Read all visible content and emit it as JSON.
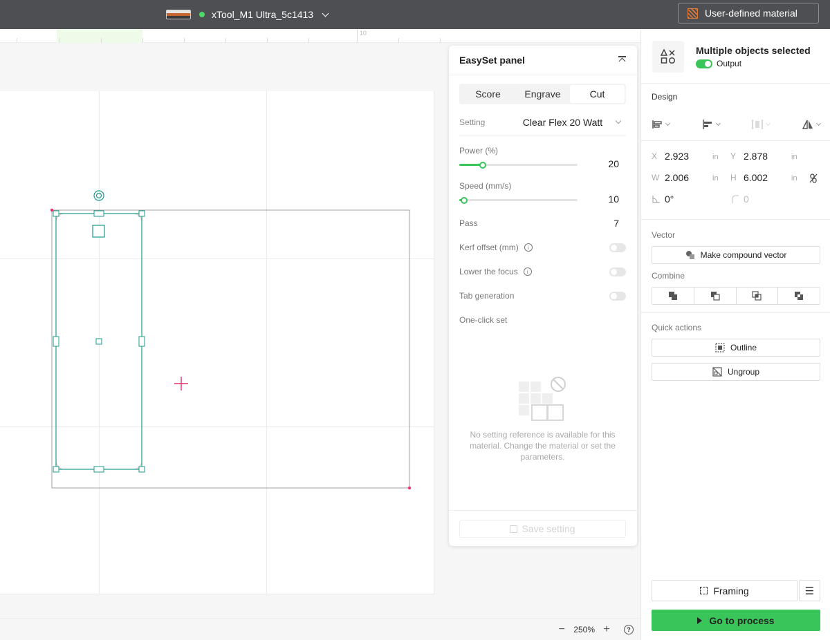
{
  "topbar": {
    "device_name": "xTool_M1 Ultra_5c1413",
    "device_status": "connected",
    "material_label": "User-defined material",
    "icons": [
      "device-thumbnail-icon",
      "chevron-down-icon",
      "material-icon"
    ]
  },
  "ruler": {
    "mark_label": "10"
  },
  "easyset": {
    "title": "EasySet panel",
    "tabs": [
      {
        "label": "Score",
        "active": false
      },
      {
        "label": "Engrave",
        "active": false
      },
      {
        "label": "Cut",
        "active": true
      }
    ],
    "setting_label": "Setting",
    "setting_value": "Clear Flex 20 Watt",
    "power": {
      "label": "Power (%)",
      "value": "20",
      "fraction": 0.2
    },
    "speed": {
      "label": "Speed (mm/s)",
      "value": "10",
      "fraction": 0.04
    },
    "pass": {
      "label": "Pass",
      "value": "7"
    },
    "kerf_label": "Kerf offset (mm)",
    "kerf_on": false,
    "lower_focus_label": "Lower the focus",
    "lower_focus_on": false,
    "tab_generation_label": "Tab generation",
    "tab_generation_on": false,
    "one_click_label": "One-click set",
    "empty_message": "No setting reference is available for this material. Change the material or set the parameters.",
    "save_label": "Save setting"
  },
  "sidebar": {
    "object_title": "Multiple objects selected",
    "output_label": "Output",
    "output_on": true,
    "design_title": "Design",
    "x_label": "X",
    "x_value": "2.923",
    "x_unit": "in",
    "y_label": "Y",
    "y_value": "2.878",
    "y_unit": "in",
    "w_label": "W",
    "w_value": "2.006",
    "w_unit": "in",
    "h_label": "H",
    "h_value": "6.002",
    "h_unit": "in",
    "rotation_value": "0°",
    "corner_value": "0",
    "vector_title": "Vector",
    "compound_label": "Make compound vector",
    "combine_title": "Combine",
    "quick_title": "Quick actions",
    "outline_label": "Outline",
    "ungroup_label": "Ungroup",
    "framing_label": "Framing",
    "process_label": "Go to process"
  },
  "footer": {
    "zoom": "250%"
  },
  "colors": {
    "accent": "#3ac55a",
    "topbar": "#4e4f53",
    "selection": "#1a9b8a",
    "origin": "#e8336b"
  }
}
